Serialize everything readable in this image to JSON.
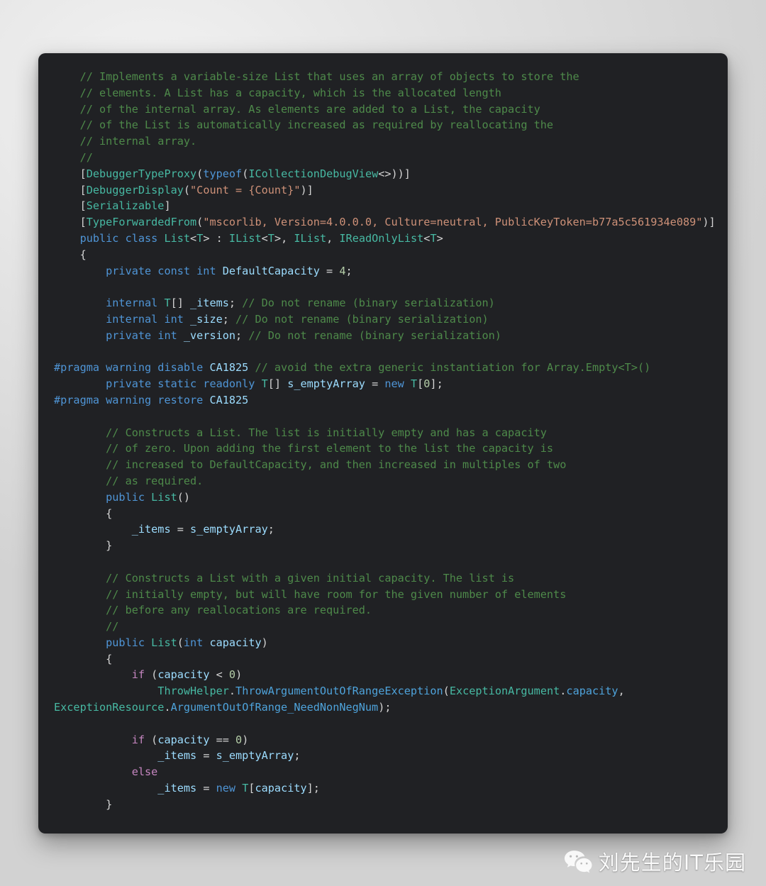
{
  "document": {
    "kind": "code-snippet-image",
    "language": "C#",
    "theme_background": "#202124",
    "page_background": "#e8e8e8"
  },
  "colors": {
    "comment": "#4e8a4a",
    "keyword": "#4f95d6",
    "control_keyword": "#c586c0",
    "type": "#47b9a3",
    "variable": "#9cdcfe",
    "function": "#4ea3db",
    "string": "#ce9178",
    "number": "#b5cea8",
    "punctuation": "#d4d4d4"
  },
  "code": {
    "lines": [
      "    // Implements a variable-size List that uses an array of objects to store the",
      "    // elements. A List has a capacity, which is the allocated length",
      "    // of the internal array. As elements are added to a List, the capacity",
      "    // of the List is automatically increased as required by reallocating the",
      "    // internal array.",
      "    //",
      "    [DebuggerTypeProxy(typeof(ICollectionDebugView<>))]",
      "    [DebuggerDisplay(\"Count = {Count}\")]",
      "    [Serializable]",
      "    [TypeForwardedFrom(\"mscorlib, Version=4.0.0.0, Culture=neutral, PublicKeyToken=b77a5c561934e089\")]",
      "    public class List<T> : IList<T>, IList, IReadOnlyList<T>",
      "    {",
      "        private const int DefaultCapacity = 4;",
      "",
      "        internal T[] _items; // Do not rename (binary serialization)",
      "        internal int _size; // Do not rename (binary serialization)",
      "        private int _version; // Do not rename (binary serialization)",
      "",
      "#pragma warning disable CA1825 // avoid the extra generic instantiation for Array.Empty<T>()",
      "        private static readonly T[] s_emptyArray = new T[0];",
      "#pragma warning restore CA1825",
      "",
      "        // Constructs a List. The list is initially empty and has a capacity",
      "        // of zero. Upon adding the first element to the list the capacity is",
      "        // increased to DefaultCapacity, and then increased in multiples of two",
      "        // as required.",
      "        public List()",
      "        {",
      "            _items = s_emptyArray;",
      "        }",
      "",
      "        // Constructs a List with a given initial capacity. The list is",
      "        // initially empty, but will have room for the given number of elements",
      "        // before any reallocations are required.",
      "        //",
      "        public List(int capacity)",
      "        {",
      "            if (capacity < 0)",
      "                ThrowHelper.ThrowArgumentOutOfRangeException(ExceptionArgument.capacity,",
      "ExceptionResource.ArgumentOutOfRange_NeedNonNegNum);",
      "",
      "            if (capacity == 0)",
      "                _items = s_emptyArray;",
      "            else",
      "                _items = new T[capacity];",
      "        }"
    ],
    "html": "<span class=\"ln\"><span class=\"cmt\">    // Implements a variable-size List that uses an array of objects to store the</span></span><span class=\"ln\"><span class=\"cmt\">    // elements. A List has a capacity, which is the allocated length</span></span><span class=\"ln\"><span class=\"cmt\">    // of the internal array. As elements are added to a List, the capacity</span></span><span class=\"ln\"><span class=\"cmt\">    // of the List is automatically increased as required by reallocating the</span></span><span class=\"ln\"><span class=\"cmt\">    // internal array.</span></span><span class=\"ln\"><span class=\"cmt\">    //</span></span><span class=\"ln\"><span class=\"pun\">    [</span><span class=\"typ\">DebuggerTypeProxy</span><span class=\"pun\">(</span><span class=\"kw\">typeof</span><span class=\"pun\">(</span><span class=\"typ\">ICollectionDebugView</span><span class=\"pun\">&lt;&gt;))]</span></span><span class=\"ln\"><span class=\"pun\">    [</span><span class=\"typ\">DebuggerDisplay</span><span class=\"pun\">(</span><span class=\"str\">\"Count = {Count}\"</span><span class=\"pun\">)]</span></span><span class=\"ln\"><span class=\"pun\">    [</span><span class=\"typ\">Serializable</span><span class=\"pun\">]</span></span><span class=\"ln\"><span class=\"pun\">    [</span><span class=\"typ\">TypeForwardedFrom</span><span class=\"pun\">(</span><span class=\"str\">\"mscorlib, Version=4.0.0.0, Culture=neutral, PublicKeyToken=b77a5c561934e089\"</span><span class=\"pun\">)]</span></span><span class=\"ln\"><span class=\"kw\">    public class </span><span class=\"typ\">List</span><span class=\"pun\">&lt;</span><span class=\"typ\">T</span><span class=\"pun\">&gt; : </span><span class=\"typ\">IList</span><span class=\"pun\">&lt;</span><span class=\"typ\">T</span><span class=\"pun\">&gt;, </span><span class=\"typ\">IList</span><span class=\"pun\">, </span><span class=\"typ\">IReadOnlyList</span><span class=\"pun\">&lt;</span><span class=\"typ\">T</span><span class=\"pun\">&gt;</span></span><span class=\"ln\"><span class=\"pun\">    {</span></span><span class=\"ln\"><span class=\"kw\">        private const int </span><span class=\"var\">DefaultCapacity</span><span class=\"pun\"> = </span><span class=\"num\">4</span><span class=\"pun\">;</span></span><span class=\"ln\"> </span><span class=\"ln\"><span class=\"kw\">        internal </span><span class=\"typ\">T</span><span class=\"pun\">[] </span><span class=\"var\">_items</span><span class=\"pun\">; </span><span class=\"cmt\">// Do not rename (binary serialization)</span></span><span class=\"ln\"><span class=\"kw\">        internal int </span><span class=\"var\">_size</span><span class=\"pun\">; </span><span class=\"cmt\">// Do not rename (binary serialization)</span></span><span class=\"ln\"><span class=\"kw\">        private int </span><span class=\"var\">_version</span><span class=\"pun\">; </span><span class=\"cmt\">// Do not rename (binary serialization)</span></span><span class=\"ln\"> </span><span class=\"ln\"><span class=\"pp\">#pragma warning disable </span><span class=\"var\">CA1825</span><span class=\"pun\"> </span><span class=\"cmt\">// avoid the extra generic instantiation for Array.Empty&lt;T&gt;()</span></span><span class=\"ln\"><span class=\"kw\">        private static readonly </span><span class=\"typ\">T</span><span class=\"pun\">[] </span><span class=\"var\">s_emptyArray</span><span class=\"pun\"> = </span><span class=\"kw\">new </span><span class=\"typ\">T</span><span class=\"pun\">[</span><span class=\"num\">0</span><span class=\"pun\">];</span></span><span class=\"ln\"><span class=\"pp\">#pragma warning restore </span><span class=\"var\">CA1825</span></span><span class=\"ln\"> </span><span class=\"ln\"><span class=\"cmt\">        // Constructs a List. The list is initially empty and has a capacity</span></span><span class=\"ln\"><span class=\"cmt\">        // of zero. Upon adding the first element to the list the capacity is</span></span><span class=\"ln\"><span class=\"cmt\">        // increased to DefaultCapacity, and then increased in multiples of two</span></span><span class=\"ln\"><span class=\"cmt\">        // as required.</span></span><span class=\"ln\"><span class=\"kw\">        public </span><span class=\"typ\">List</span><span class=\"pun\">()</span></span><span class=\"ln\"><span class=\"pun\">        {</span></span><span class=\"ln\"><span class=\"var\">            _items</span><span class=\"pun\"> = </span><span class=\"var\">s_emptyArray</span><span class=\"pun\">;</span></span><span class=\"ln\"><span class=\"pun\">        }</span></span><span class=\"ln\"> </span><span class=\"ln\"><span class=\"cmt\">        // Constructs a List with a given initial capacity. The list is</span></span><span class=\"ln\"><span class=\"cmt\">        // initially empty, but will have room for the given number of elements</span></span><span class=\"ln\"><span class=\"cmt\">        // before any reallocations are required.</span></span><span class=\"ln\"><span class=\"cmt\">        //</span></span><span class=\"ln\"><span class=\"kw\">        public </span><span class=\"typ\">List</span><span class=\"pun\">(</span><span class=\"kw\">int </span><span class=\"var\">capacity</span><span class=\"pun\">)</span></span><span class=\"ln\"><span class=\"pun\">        {</span></span><span class=\"ln\"><span class=\"ctl\">            if </span><span class=\"pun\">(</span><span class=\"var\">capacity</span><span class=\"pun\"> &lt; </span><span class=\"num\">0</span><span class=\"pun\">)</span></span><span class=\"ln\"><span class=\"typ\">                ThrowHelper</span><span class=\"pun\">.</span><span class=\"fn\">ThrowArgumentOutOfRangeException</span><span class=\"pun\">(</span><span class=\"typ\">ExceptionArgument</span><span class=\"pun\">.</span><span class=\"fn\">capacity</span><span class=\"pun\">,</span></span><span class=\"ln\"><span class=\"typ\">ExceptionResource</span><span class=\"pun\">.</span><span class=\"fn\">ArgumentOutOfRange_NeedNonNegNum</span><span class=\"pun\">);</span></span><span class=\"ln\"> </span><span class=\"ln\"><span class=\"ctl\">            if </span><span class=\"pun\">(</span><span class=\"var\">capacity</span><span class=\"pun\"> == </span><span class=\"num\">0</span><span class=\"pun\">)</span></span><span class=\"ln\"><span class=\"var\">                _items</span><span class=\"pun\"> = </span><span class=\"var\">s_emptyArray</span><span class=\"pun\">;</span></span><span class=\"ln\"><span class=\"ctl\">            else</span></span><span class=\"ln\"><span class=\"var\">                _items</span><span class=\"pun\"> = </span><span class=\"kw\">new </span><span class=\"typ\">T</span><span class=\"pun\">[</span><span class=\"var\">capacity</span><span class=\"pun\">];</span></span><span class=\"ln\"><span class=\"pun\">        }</span></span>"
  },
  "watermark": {
    "text": "刘先生的IT乐园",
    "icon": "wechat-icon",
    "color": "#ffffff"
  }
}
